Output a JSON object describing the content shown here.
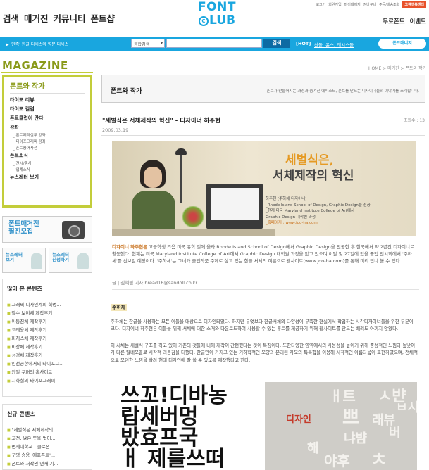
{
  "nav": {
    "items": [
      "검색",
      "매거진",
      "커뮤니티",
      "폰트샵"
    ],
    "right": [
      "무료폰트",
      "이벤트"
    ]
  },
  "logo": {
    "line1": "FONT",
    "c": "C",
    "line2": "LUB"
  },
  "util": {
    "links": [
      "로그인",
      "회원가입",
      "마이페이지",
      "장바구니",
      "주문/배송조회"
    ],
    "pay": "고객행복센터"
  },
  "bluebar": {
    "promo": "▶ '민족' 한글 디세스와 영문 디세스",
    "select": "통합검색",
    "search_button": "검색",
    "hot": "[HOT]",
    "hot_links": "산돌, 윤스, 태시스돌",
    "badge": "폰트매니저"
  },
  "sidebar": {
    "mag_title": "MAGAZINE",
    "mag_o": "Z",
    "menu_head": "폰트와 작가",
    "items": [
      {
        "label": "타이포 리뷰",
        "subs": []
      },
      {
        "label": "타이포 컬럼",
        "subs": []
      },
      {
        "label": "폰트클럽이 간다",
        "subs": []
      },
      {
        "label": "강좌",
        "subs": [
          "폰트제작실무 강좌",
          "타이포그래피 강좌",
          "폰트용어사전"
        ]
      },
      {
        "label": "폰트소식",
        "subs": [
          "전시/행사",
          "업계소식"
        ]
      },
      {
        "label": "뉴스레터 보기",
        "subs": []
      }
    ],
    "banner": "폰트매거진\n필진모집",
    "news1": "뉴스레터\n보기",
    "news2": "뉴스레터\n신청하기",
    "popular_head": "많이 본 콘텐츠",
    "popular": [
      "그래픽 디자인계의 혁명...",
      "활수 보이체 제작후기",
      "이동진체 제작후기",
      "코레용체 제작후기",
      "피치스체 제작후기",
      "비상체 제작후기",
      "성경체 제작후기",
      "인천공항에서의 타이포그...",
      "카일 쿠퍼의 홈사이트",
      "지하철의 타이포그래피"
    ],
    "new_head": "신규 콘텐츠",
    "new": [
      "\"세벌식은 서체제작의...",
      "고전, 낡은 듯을 벗어...",
      "면세대학교 - 콜로폰",
      "구명 승용 '에포폰트'...",
      "폰트와 저작권 연재 기..."
    ]
  },
  "breadcrumb": "HOME > 매거진 > 폰트와 작가",
  "header": {
    "title": "폰트와 작가",
    "desc": "폰트가 만들어지는 과정과 숨겨진 에피소드, 폰트를 만드는 디자이너들의 이야기를 소개합니다."
  },
  "article": {
    "title": "\"세벌식은 서체제작의 혁신\" - 디자이너 하주현",
    "views": "조회수 : 13",
    "date": "2009.03.19",
    "hero_h1": "세벌식은,",
    "hero_h2": "서체제작의 혁신",
    "cred": [
      "하주현 (주하체 디자이너)",
      "_Rhode Island School of Design, Graphic Design을 전공",
      "_현재 미국 Maryland Institute College of Art에서",
      "  Graphic Design 대학원 과정",
      "_홈페이지 : www.joo-ha.com"
    ],
    "intro_name": "디자이너 하주현은",
    "intro": " 고등학생 즈음 미국 유학 길에 올라 Rhode Island School of Design에서 Graphic Design을 전공한 후 한국에서 약 2년간 디자이너로 활동했다. 현재는 미국 Maryland Institute College of Art에서 Graphic Design 대학원 과정을 밟고 있으며 이달 및 27일에 있을 졸업 전시회에서 '주하체'를 선보일 예정이다. '주하체'는 그녀가 졸업작품 주제로 삼고 있는 한글 서체의 이름으로 웹사이트(www.joo-ha.com)를 통해 미리 만나 볼 수 있다.",
    "byline": "글 | 김혜림 기자 bread16@sandoll.co.kr",
    "section": "주하체",
    "p1": "주하체는 한글을 사용하는 모든 이들을 대상으로 디자인되었다. 하지만 무엇보다 한글서체의 다양성이 부족한 현실에서 작업하는 시각디자이너들을 위한 부분이 크다. 디자이너 하주현은 이들을 위해 서체에 대한 소개와 다운로드하여 사용할 수 있는 루트를 제공하기 위해 웹사이트를 만드는 배려도 아끼지 않았다.",
    "p2": "이 서체는 세벌식 구조를 하고 있어 기존의 것들에 비해 제작이 간편했다는 것이 특징이다. 또한다양한 영역에서의 사용성을 높이기 위해 중성적인 느낌과 높낮이가 다른 탈네모꼴로 시각적 리듬감을 더했다. 한글만이 가지고 있는 기하학적인 모양과 분리된 자모의 독특함을 이용해 시각적인 아름다움이 표현하였으며, 전체적으로 모던한 느낌을 살려 현대 디자인에 잘 쓸 수 있도록 제작했다고 한다."
  },
  "img1_lines": [
    "쓰꼬!디바농",
    "랍세버멍",
    "밨효프국",
    "ㅐ 제를쓰떠"
  ],
  "img2": {
    "label": "디자인",
    "glyphs": [
      "ㅐ트",
      "쁘",
      "냐뱜",
      "ㅅ뱐",
      "ㅂ시",
      "래뷰",
      "버",
      "해",
      "야후",
      "ㅊ"
    ]
  }
}
